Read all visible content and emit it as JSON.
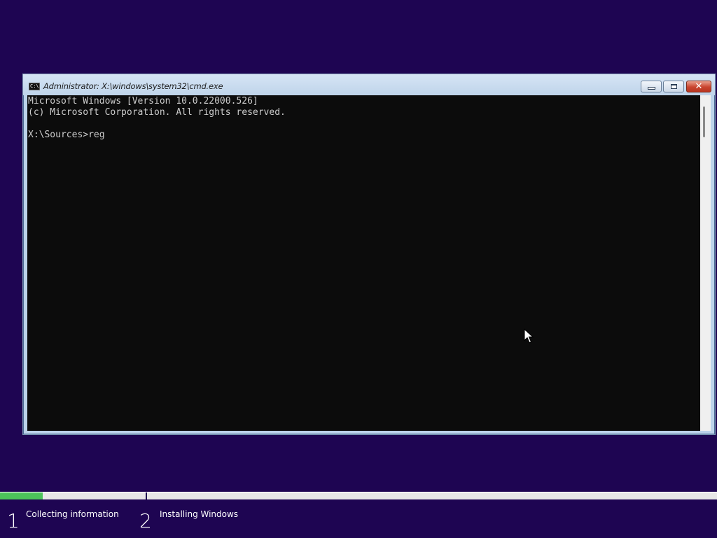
{
  "window": {
    "title": "Administrator: X:\\windows\\system32\\cmd.exe",
    "icon_label": "C:\\",
    "controls": {
      "minimize_icon": "minimize-icon",
      "maximize_icon": "maximize-icon",
      "close_icon": "close-icon",
      "close_glyph": "✕"
    }
  },
  "console": {
    "lines": [
      "Microsoft Windows [Version 10.0.22000.526]",
      "(c) Microsoft Corporation. All rights reserved.",
      "",
      "X:\\Sources>reg"
    ],
    "background_color": "#0c0c0c",
    "text_color": "#cccccc"
  },
  "setup": {
    "progress": 0.06,
    "steps": [
      {
        "number": "1",
        "label": "Collecting information"
      },
      {
        "number": "2",
        "label": "Installing Windows"
      }
    ],
    "background_color": "#1e0552",
    "progress_color": "#4cc35a"
  }
}
